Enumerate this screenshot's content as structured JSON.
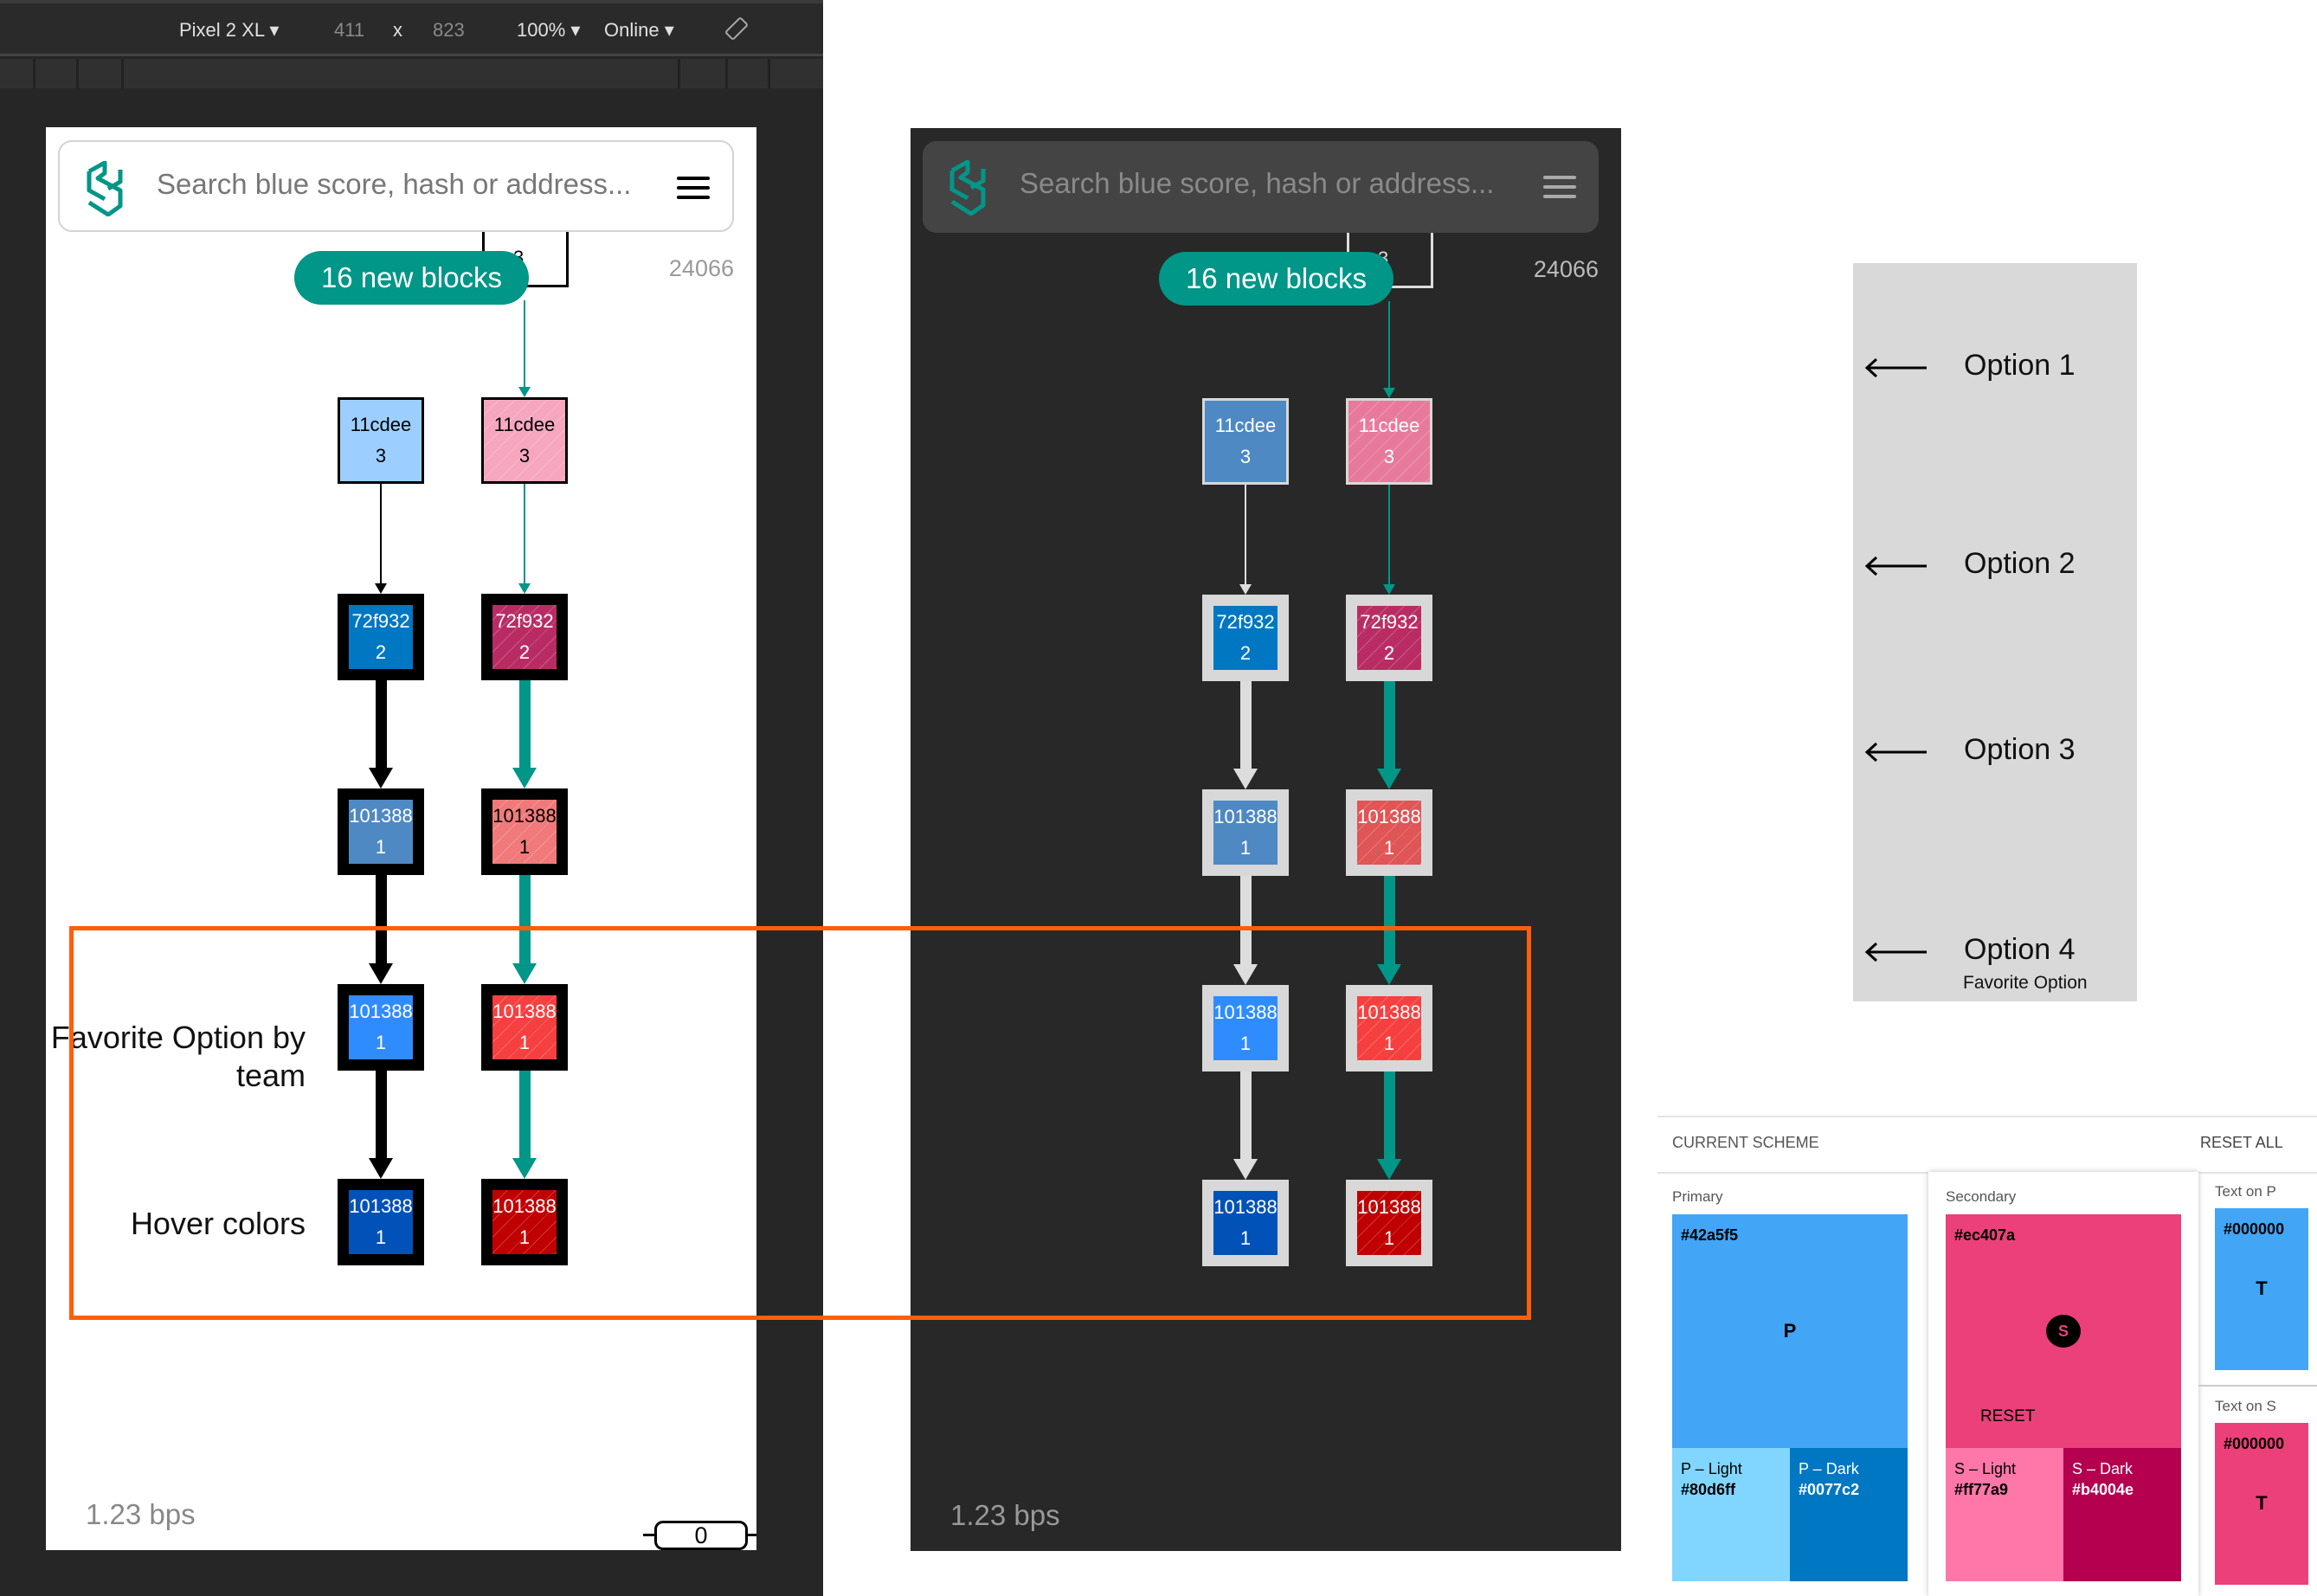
{
  "devtools": {
    "device": "Pixel 2 XL",
    "width": "411",
    "times": "x",
    "height": "823",
    "zoom": "100%",
    "network": "Online",
    "rotate_icon": "rotate-icon"
  },
  "explorer": {
    "search_placeholder": "Search blue score, hash or address...",
    "new_blocks": "16 new blocks",
    "partial_block_score": "3",
    "blue_score": "24066",
    "rate": "1.23 bps",
    "counter": "0",
    "accent": "#009688",
    "rows": [
      {
        "hash": "11cdee",
        "score": "3"
      },
      {
        "hash": "72f932",
        "score": "2"
      },
      {
        "hash": "101388",
        "score": "1"
      },
      {
        "hash": "101388",
        "score": "1"
      },
      {
        "hash": "101388",
        "score": "1"
      }
    ],
    "themes": {
      "light": {
        "col1": [
          "#9ccfff",
          "#0077c2",
          "#4f89c3",
          "#2f8cff",
          "#0052b8"
        ],
        "col2": [
          "#f7a6c0",
          "#b92c63",
          "#f07a7a",
          "#f63f3f",
          "#c00000"
        ],
        "border": "#000000",
        "edge1": "#000000"
      },
      "dark": {
        "col1": [
          "#4f89c3",
          "#0077c2",
          "#4f89c3",
          "#2f8cff",
          "#0052b8"
        ],
        "col2": [
          "#e77a9c",
          "#b92c63",
          "#e05555",
          "#f63f3f",
          "#c00000"
        ],
        "border": "#d8d8d8",
        "edge1": "#dddddd"
      }
    }
  },
  "annotations": {
    "favorite": "Favorite Option by team",
    "hover": "Hover colors",
    "highlight_color": "#ff5e0a"
  },
  "options": [
    {
      "label": "Option 1"
    },
    {
      "label": "Option 2"
    },
    {
      "label": "Option 3"
    },
    {
      "label": "Option 4",
      "note": "Favorite Option"
    }
  ],
  "scheme": {
    "title": "CURRENT SCHEME",
    "reset_all": "RESET ALL",
    "primary": {
      "label": "Primary",
      "hex": "#42a5f5",
      "letter": "P",
      "light_label": "P – Light",
      "light_hex": "#80d6ff",
      "dark_label": "P – Dark",
      "dark_hex": "#0077c2"
    },
    "secondary": {
      "label": "Secondary",
      "hex": "#ec407a",
      "letter": "S",
      "reset": "RESET",
      "light_label": "S – Light",
      "light_hex": "#ff77a9",
      "dark_label": "S – Dark",
      "dark_hex": "#b4004e"
    },
    "text_on_p": {
      "label": "Text on P",
      "hex": "#000000",
      "letter": "T"
    },
    "text_on_s": {
      "label": "Text on S",
      "hex": "#000000",
      "letter": "T"
    }
  }
}
